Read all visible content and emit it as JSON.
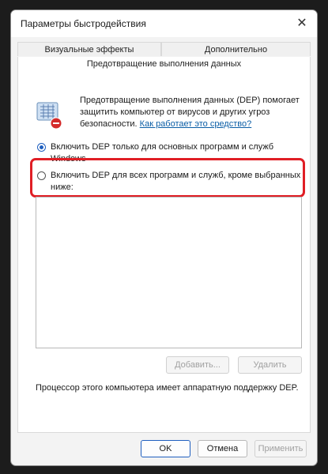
{
  "window": {
    "title": "Параметры быстродействия",
    "close_glyph": "✕"
  },
  "tabs": [
    {
      "label": "Визуальные эффекты"
    },
    {
      "label": "Дополнительно"
    }
  ],
  "active_tab": {
    "label": "Предотвращение выполнения данных"
  },
  "description": {
    "text": "Предотвращение выполнения данных (DEP) помогает защитить компьютер от вирусов и других угроз безопасности.",
    "link": "Как работает это средство?"
  },
  "options": [
    {
      "label": "Включить DEP только для основных программ и служб Windows",
      "checked": true
    },
    {
      "label": "Включить DEP для всех программ и служб, кроме выбранных ниже:",
      "checked": false
    }
  ],
  "list_buttons": {
    "add": "Добавить...",
    "remove": "Удалить"
  },
  "support_text": "Процессор этого компьютера имеет аппаратную поддержку DEP.",
  "footer": {
    "ok": "OK",
    "cancel": "Отмена",
    "apply": "Применить"
  },
  "colors": {
    "highlight": "#e01e25",
    "accent": "#1f5fbf",
    "link": "#0b5ea6"
  }
}
